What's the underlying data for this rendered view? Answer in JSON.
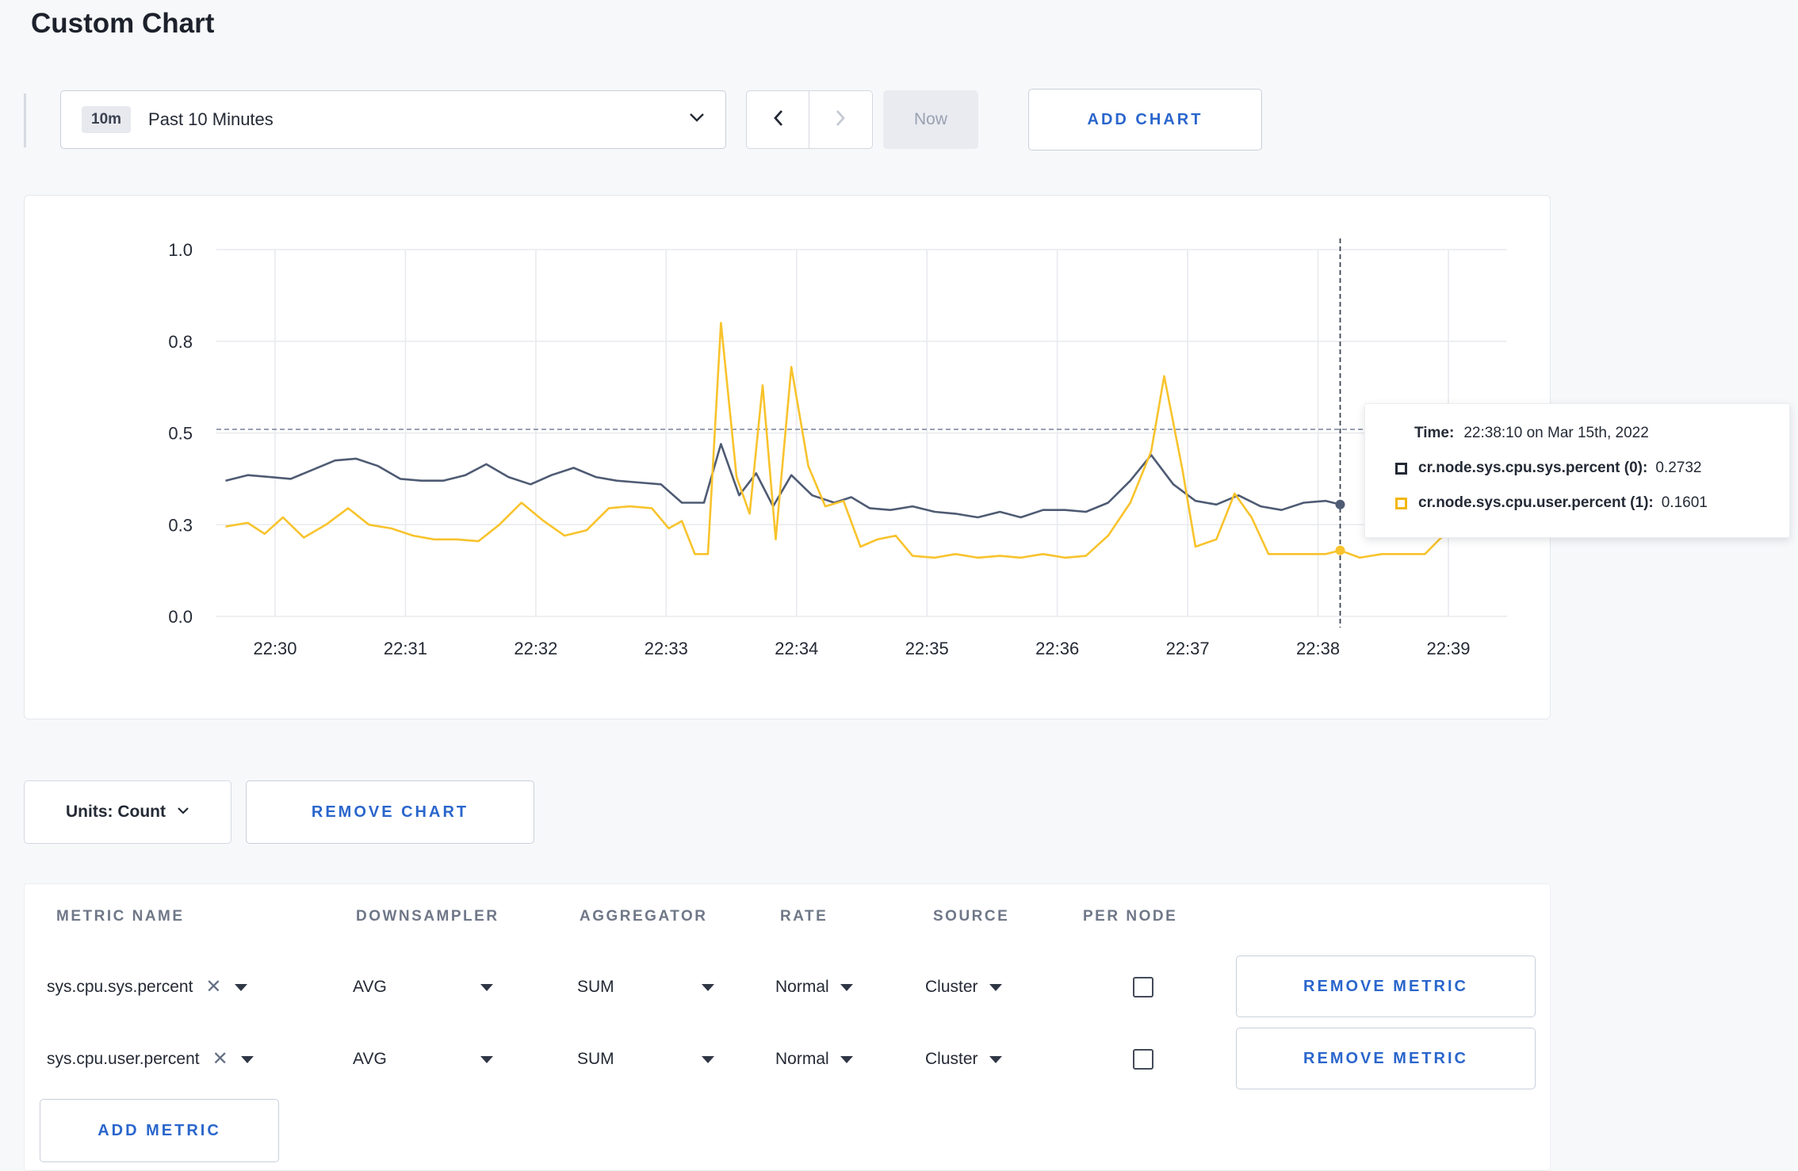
{
  "page": {
    "title": "Custom Chart"
  },
  "toolbar": {
    "time_range_badge": "10m",
    "time_range_label": "Past 10 Minutes",
    "now_label": "Now",
    "add_chart_label": "ADD CHART"
  },
  "chart_controls": {
    "units_label": "Units: Count",
    "remove_chart_label": "REMOVE CHART"
  },
  "colors": {
    "accent_blue": "#2a66cc",
    "series_sys": "#4e5b73",
    "series_user": "#f8c32c",
    "gridline": "#e8eaee",
    "threshold": "#8a93a6",
    "crosshair": "#3c4452"
  },
  "chart_data": {
    "type": "line",
    "title": "",
    "x_axis": {
      "labels": [
        "22:30",
        "22:31",
        "22:32",
        "22:33",
        "22:34",
        "22:35",
        "22:36",
        "22:37",
        "22:38",
        "22:39"
      ],
      "tick_minutes": [
        30,
        31,
        32,
        33,
        34,
        35,
        36,
        37,
        38,
        39
      ],
      "range_minutes": [
        29.55,
        39.45
      ]
    },
    "y_axis": {
      "ticks": [
        0,
        0.25,
        0.5,
        0.75,
        1.0
      ],
      "labels": [
        "0.0",
        "0.3",
        "0.5",
        "0.8",
        "1.0"
      ],
      "range": [
        0,
        1
      ]
    },
    "grid": true,
    "legend_position": "tooltip",
    "threshold_line": 0.51,
    "crosshair": {
      "x_minute": 38.17
    },
    "series": [
      {
        "name": "cr.node.sys.cpu.sys.percent",
        "color": "#4e5b73",
        "marker": [
          38.17,
          0.305
        ],
        "points": [
          [
            29.62,
            0.37
          ],
          [
            29.79,
            0.385
          ],
          [
            29.96,
            0.38
          ],
          [
            30.12,
            0.375
          ],
          [
            30.29,
            0.4
          ],
          [
            30.46,
            0.425
          ],
          [
            30.62,
            0.43
          ],
          [
            30.79,
            0.41
          ],
          [
            30.96,
            0.375
          ],
          [
            31.12,
            0.37
          ],
          [
            31.29,
            0.37
          ],
          [
            31.46,
            0.385
          ],
          [
            31.62,
            0.415
          ],
          [
            31.79,
            0.38
          ],
          [
            31.96,
            0.36
          ],
          [
            32.12,
            0.385
          ],
          [
            32.29,
            0.405
          ],
          [
            32.46,
            0.38
          ],
          [
            32.62,
            0.37
          ],
          [
            32.79,
            0.365
          ],
          [
            32.96,
            0.36
          ],
          [
            33.12,
            0.31
          ],
          [
            33.29,
            0.31
          ],
          [
            33.42,
            0.47
          ],
          [
            33.56,
            0.33
          ],
          [
            33.69,
            0.39
          ],
          [
            33.82,
            0.3
          ],
          [
            33.96,
            0.385
          ],
          [
            34.12,
            0.33
          ],
          [
            34.29,
            0.31
          ],
          [
            34.42,
            0.325
          ],
          [
            34.56,
            0.295
          ],
          [
            34.72,
            0.29
          ],
          [
            34.89,
            0.3
          ],
          [
            35.06,
            0.285
          ],
          [
            35.22,
            0.28
          ],
          [
            35.39,
            0.27
          ],
          [
            35.56,
            0.285
          ],
          [
            35.72,
            0.27
          ],
          [
            35.89,
            0.29
          ],
          [
            36.06,
            0.29
          ],
          [
            36.22,
            0.285
          ],
          [
            36.39,
            0.31
          ],
          [
            36.56,
            0.37
          ],
          [
            36.72,
            0.44
          ],
          [
            36.89,
            0.36
          ],
          [
            37.06,
            0.315
          ],
          [
            37.22,
            0.305
          ],
          [
            37.39,
            0.33
          ],
          [
            37.56,
            0.3
          ],
          [
            37.72,
            0.29
          ],
          [
            37.89,
            0.31
          ],
          [
            38.06,
            0.315
          ],
          [
            38.17,
            0.305
          ]
        ]
      },
      {
        "name": "cr.node.sys.cpu.user.percent",
        "color": "#f8c32c",
        "marker": [
          38.17,
          0.18
        ],
        "points": [
          [
            29.62,
            0.245
          ],
          [
            29.79,
            0.255
          ],
          [
            29.92,
            0.225
          ],
          [
            30.06,
            0.27
          ],
          [
            30.22,
            0.215
          ],
          [
            30.39,
            0.25
          ],
          [
            30.56,
            0.295
          ],
          [
            30.72,
            0.25
          ],
          [
            30.89,
            0.24
          ],
          [
            31.06,
            0.22
          ],
          [
            31.22,
            0.21
          ],
          [
            31.39,
            0.21
          ],
          [
            31.56,
            0.205
          ],
          [
            31.72,
            0.25
          ],
          [
            31.89,
            0.31
          ],
          [
            32.06,
            0.26
          ],
          [
            32.22,
            0.22
          ],
          [
            32.39,
            0.235
          ],
          [
            32.56,
            0.295
          ],
          [
            32.72,
            0.3
          ],
          [
            32.89,
            0.295
          ],
          [
            33.02,
            0.24
          ],
          [
            33.12,
            0.26
          ],
          [
            33.22,
            0.17
          ],
          [
            33.32,
            0.17
          ],
          [
            33.42,
            0.8
          ],
          [
            33.54,
            0.38
          ],
          [
            33.64,
            0.28
          ],
          [
            33.74,
            0.63
          ],
          [
            33.84,
            0.21
          ],
          [
            33.96,
            0.68
          ],
          [
            34.09,
            0.41
          ],
          [
            34.22,
            0.3
          ],
          [
            34.36,
            0.315
          ],
          [
            34.49,
            0.19
          ],
          [
            34.62,
            0.21
          ],
          [
            34.76,
            0.22
          ],
          [
            34.89,
            0.165
          ],
          [
            35.06,
            0.16
          ],
          [
            35.22,
            0.17
          ],
          [
            35.39,
            0.16
          ],
          [
            35.56,
            0.165
          ],
          [
            35.72,
            0.16
          ],
          [
            35.89,
            0.17
          ],
          [
            36.06,
            0.16
          ],
          [
            36.22,
            0.165
          ],
          [
            36.39,
            0.22
          ],
          [
            36.56,
            0.31
          ],
          [
            36.72,
            0.45
          ],
          [
            36.82,
            0.655
          ],
          [
            36.96,
            0.4
          ],
          [
            37.06,
            0.19
          ],
          [
            37.22,
            0.21
          ],
          [
            37.36,
            0.335
          ],
          [
            37.49,
            0.27
          ],
          [
            37.62,
            0.17
          ],
          [
            37.76,
            0.17
          ],
          [
            37.89,
            0.17
          ],
          [
            38.06,
            0.17
          ],
          [
            38.17,
            0.18
          ],
          [
            38.32,
            0.16
          ],
          [
            38.49,
            0.17
          ],
          [
            38.66,
            0.17
          ],
          [
            38.82,
            0.17
          ],
          [
            38.96,
            0.22
          ],
          [
            39.12,
            0.265
          ],
          [
            39.26,
            0.3
          ],
          [
            39.36,
            0.27
          ]
        ]
      }
    ],
    "tooltip": {
      "time_label": "Time:",
      "time_value": "22:38:10 on Mar 15th, 2022",
      "rows": [
        {
          "label": "cr.node.sys.cpu.sys.percent (0):",
          "value": "0.2732",
          "color": "#242a35"
        },
        {
          "label": "cr.node.sys.cpu.user.percent (1):",
          "value": "0.1601",
          "color": "#f2b70a"
        }
      ]
    }
  },
  "metrics_table": {
    "headers": [
      "METRIC NAME",
      "DOWNSAMPLER",
      "AGGREGATOR",
      "RATE",
      "SOURCE",
      "PER NODE"
    ],
    "rows": [
      {
        "metric": "sys.cpu.sys.percent",
        "downsampler": "AVG",
        "aggregator": "SUM",
        "rate": "Normal",
        "source": "Cluster",
        "per_node": false,
        "remove_label": "REMOVE METRIC"
      },
      {
        "metric": "sys.cpu.user.percent",
        "downsampler": "AVG",
        "aggregator": "SUM",
        "rate": "Normal",
        "source": "Cluster",
        "per_node": false,
        "remove_label": "REMOVE METRIC"
      }
    ],
    "add_metric_label": "ADD METRIC"
  }
}
